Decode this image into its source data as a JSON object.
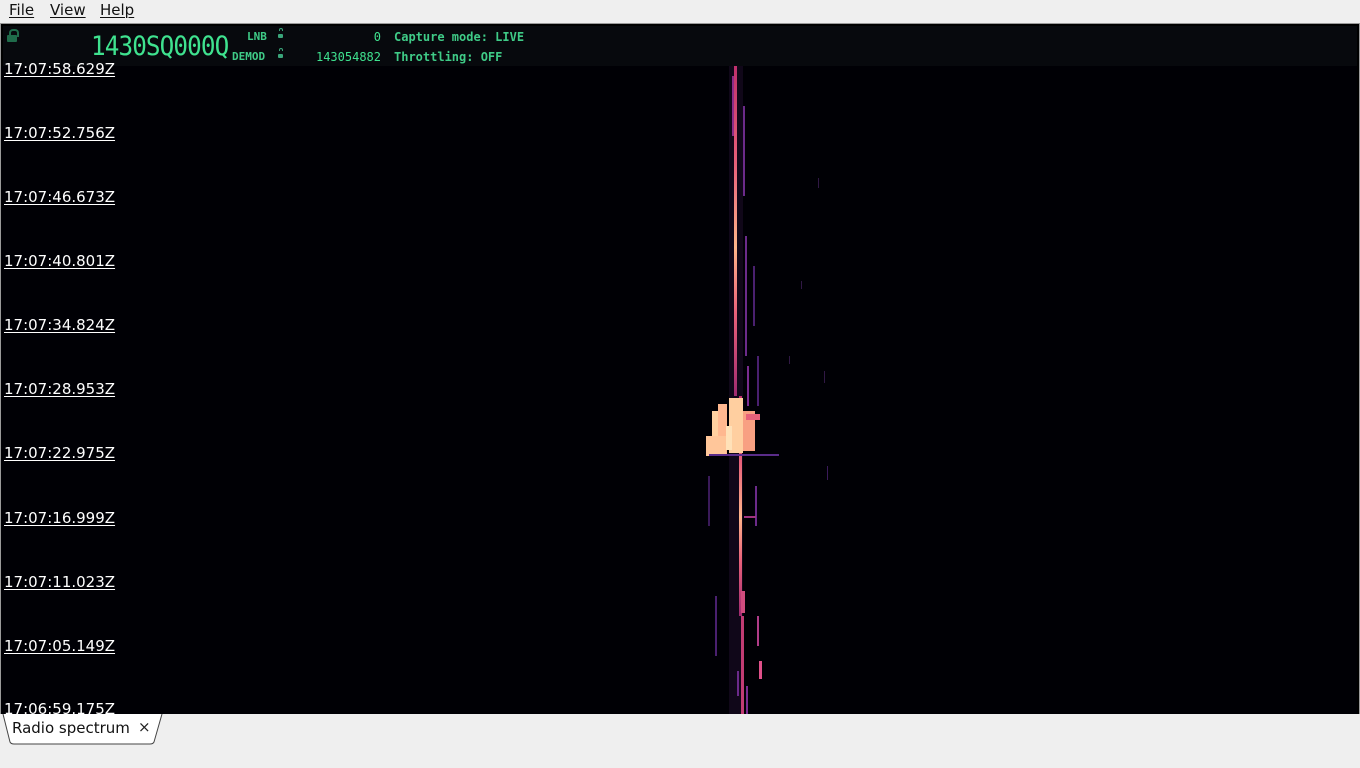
{
  "menu": {
    "file": "File",
    "view": "View",
    "help": "Help"
  },
  "header": {
    "main_frequency": "1430SQ000Q",
    "lnb_label": "LNB",
    "lnb_value": "0",
    "demod_label": "DEMOD",
    "demod_value": "143054882",
    "capture_mode": "Capture mode: LIVE",
    "throttling": "Throttling: OFF"
  },
  "waterfall": {
    "timestamps": [
      "17:07:58.629Z",
      "17:07:52.756Z",
      "17:07:46.673Z",
      "17:07:40.801Z",
      "17:07:34.824Z",
      "17:07:28.953Z",
      "17:07:22.975Z",
      "17:07:16.999Z",
      "17:07:11.023Z",
      "17:07:05.149Z",
      "17:06:59.175Z"
    ]
  },
  "tabs": [
    {
      "label": "Radio spectrum",
      "close": "×"
    }
  ],
  "colors": {
    "accent": "#3fe28f",
    "signal_hot": "#ffd9a8",
    "signal_mid": "#e0508a",
    "signal_low": "#5a2c8a"
  }
}
